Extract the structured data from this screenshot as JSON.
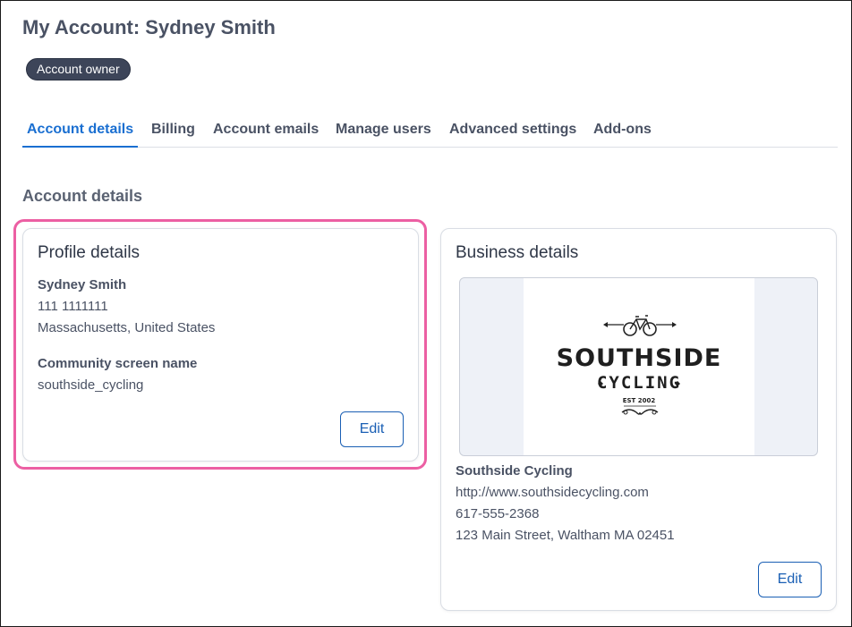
{
  "header": {
    "title": "My Account: Sydney Smith",
    "badge": "Account owner"
  },
  "tabs": [
    {
      "label": "Account details",
      "active": true
    },
    {
      "label": "Billing",
      "active": false
    },
    {
      "label": "Account emails",
      "active": false
    },
    {
      "label": "Manage users",
      "active": false
    },
    {
      "label": "Advanced settings",
      "active": false
    },
    {
      "label": "Add-ons",
      "active": false
    }
  ],
  "section_title": "Account details",
  "profile": {
    "title": "Profile details",
    "name": "Sydney Smith",
    "phone": "111 1111111",
    "location": "Massachusetts, United States",
    "community_label": "Community screen name",
    "community_value": "southside_cycling",
    "edit_label": "Edit"
  },
  "business": {
    "title": "Business details",
    "logo": {
      "name_text": "SOUTHSIDE",
      "sub_text": "CYCLING",
      "est_text": "EST 2002",
      "icon": "bicycle-icon"
    },
    "name": "Southside Cycling",
    "website": "http://www.southsidecycling.com",
    "phone": "617-555-2368",
    "address": "123 Main Street, Waltham MA 02451",
    "edit_label": "Edit"
  },
  "colors": {
    "accent": "#1a6fd1",
    "badge_bg": "#3d4559",
    "highlight": "#ec5fa3"
  }
}
